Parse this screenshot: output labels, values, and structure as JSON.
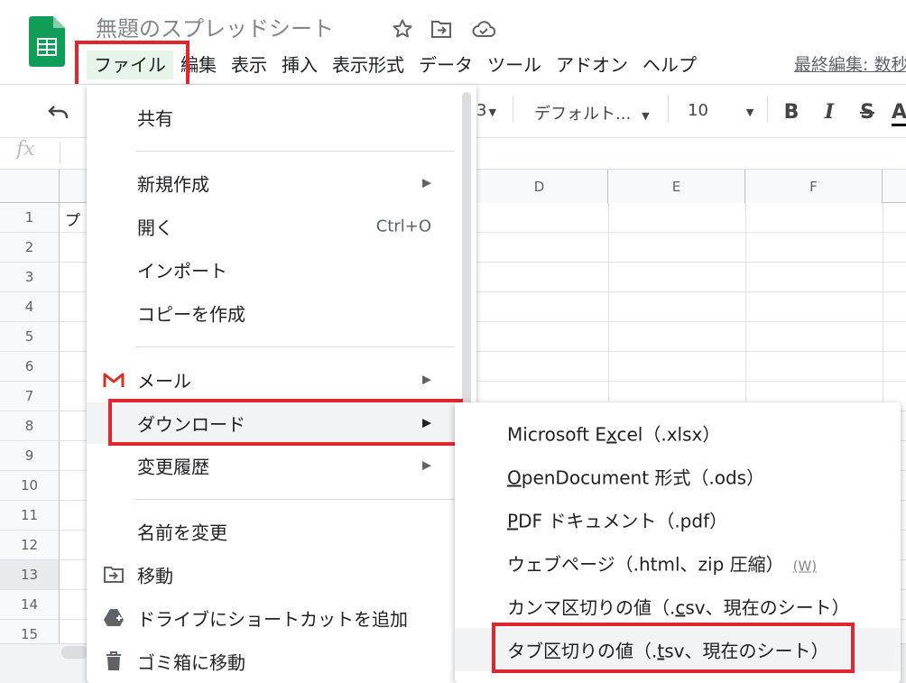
{
  "app": {
    "doc_title": "無題のスプレッドシート",
    "brand_color": "#0f9d58"
  },
  "menubar": {
    "items": [
      {
        "label": "ファイル",
        "active": true
      },
      {
        "label": "編集"
      },
      {
        "label": "表示"
      },
      {
        "label": "挿入"
      },
      {
        "label": "表示形式"
      },
      {
        "label": "データ"
      },
      {
        "label": "ツール"
      },
      {
        "label": "アドオン"
      },
      {
        "label": "ヘルプ"
      }
    ],
    "last_edit": "最終編集: 数秒"
  },
  "toolbar": {
    "format_num_fragment": "3",
    "font_name": "デフォルト...",
    "font_size": "10",
    "bold": "B",
    "italic": "I",
    "strike": "S",
    "text_color": "A"
  },
  "formula_bar": {
    "fx": "fx"
  },
  "grid": {
    "columns": [
      "D",
      "E",
      "F"
    ],
    "rows": [
      "1",
      "2",
      "3",
      "4",
      "5",
      "6",
      "7",
      "8",
      "9",
      "10",
      "11",
      "12",
      "13",
      "14",
      "15"
    ],
    "selected_row": "13",
    "cell_a1_fragment": "プ"
  },
  "file_menu": {
    "share": "共有",
    "new": "新規作成",
    "open": "開く",
    "open_shortcut": "Ctrl+O",
    "import": "インポート",
    "make_copy": "コピーを作成",
    "email": "メール",
    "download": "ダウンロード",
    "version_history": "変更履歴",
    "rename": "名前を変更",
    "move": "移動",
    "add_shortcut": "ドライブにショートカットを追加",
    "trash": "ゴミ箱に移動"
  },
  "download_menu": {
    "xlsx_pre": "Microsoft E",
    "xlsx_key": "x",
    "xlsx_post": "cel（.xlsx）",
    "ods_key": "O",
    "ods_post": "penDocument 形式（.ods）",
    "pdf_key": "P",
    "pdf_post": "DF ドキュメント（.pdf）",
    "html": "ウェブページ（.html、zip 圧縮）",
    "html_hint": "(W)",
    "csv_pre": "カンマ区切りの値（.",
    "csv_key": "c",
    "csv_post": "sv、現在のシート）",
    "tsv_pre": "タブ区切りの値（.",
    "tsv_key": "t",
    "tsv_post": "sv、現在のシート）"
  },
  "highlight_color": "#e0262f"
}
